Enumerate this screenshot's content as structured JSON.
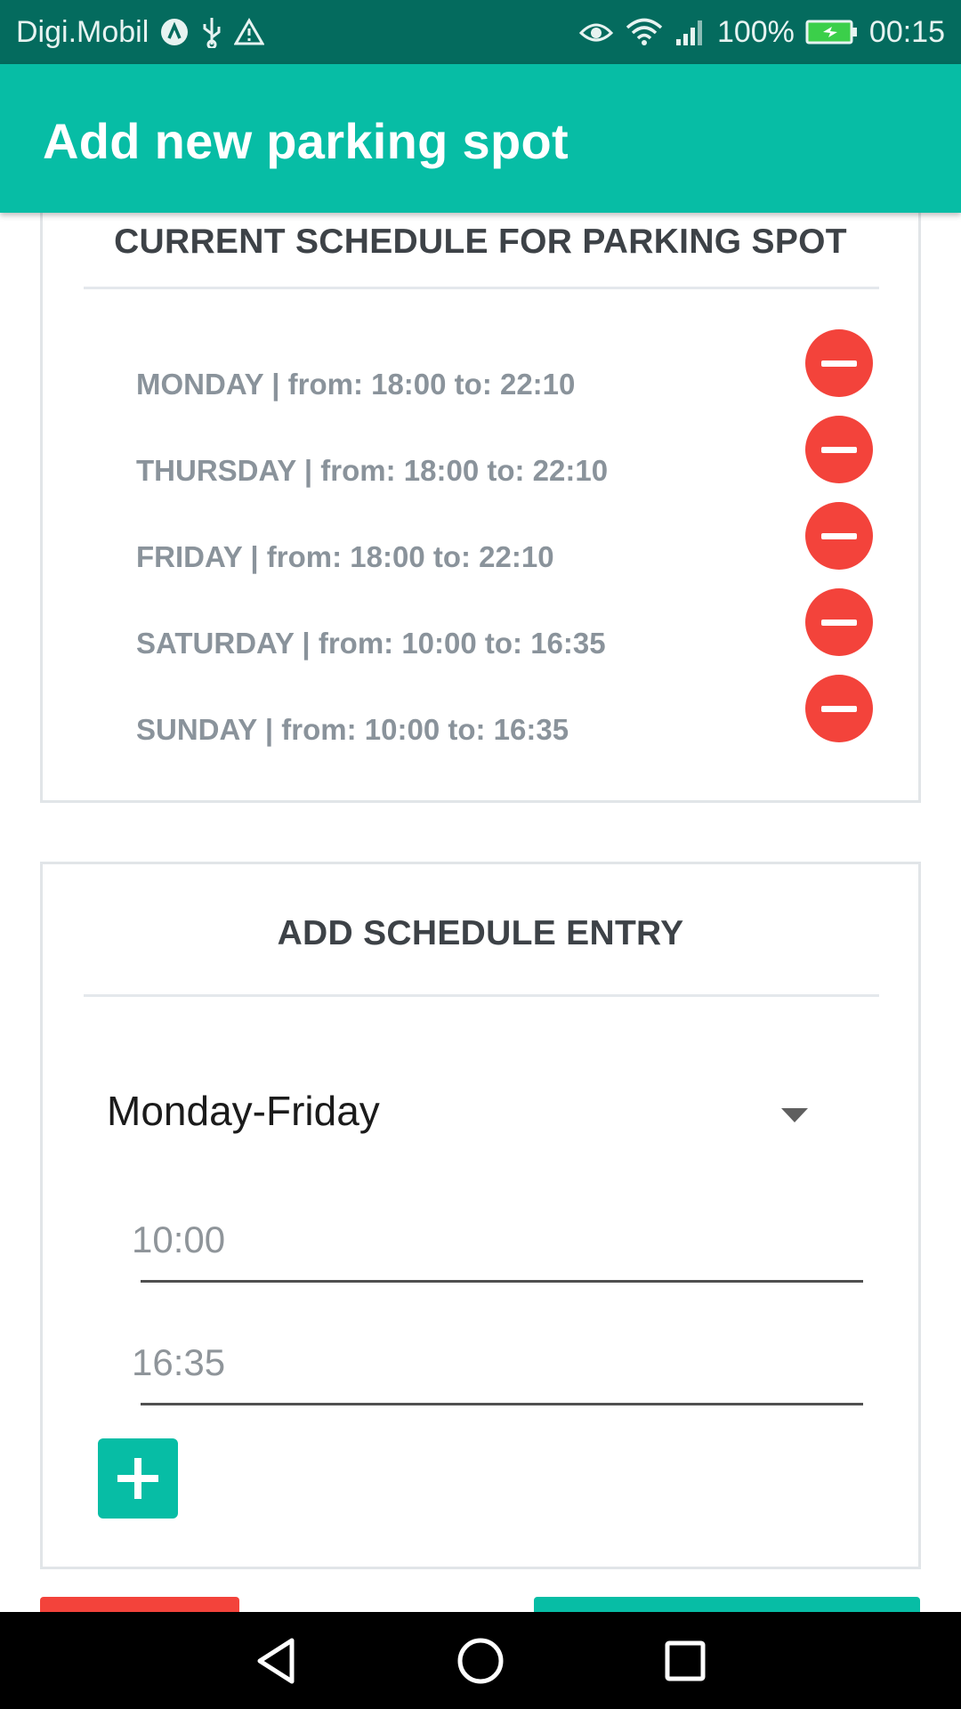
{
  "status_bar": {
    "carrier": "Digi.Mobil",
    "battery": "100%",
    "time": "00:15",
    "icons": [
      "carrier-logo-icon",
      "usb-icon",
      "warning-icon",
      "eye-icon",
      "wifi-icon",
      "signal-icon",
      "battery-charging-icon"
    ]
  },
  "app_bar": {
    "title": "Add new parking spot"
  },
  "schedule_card": {
    "title": "CURRENT SCHEDULE FOR PARKING SPOT",
    "entries": [
      {
        "text": "MONDAY | from: 18:00 to: 22:10"
      },
      {
        "text": "THURSDAY | from: 18:00 to: 22:10"
      },
      {
        "text": "FRIDAY | from: 18:00 to: 22:10"
      },
      {
        "text": "SATURDAY | from: 10:00 to: 16:35"
      },
      {
        "text": "SUNDAY | from: 10:00 to: 16:35"
      }
    ],
    "remove_icon": "minus-circle-icon"
  },
  "add_card": {
    "title": "ADD SCHEDULE ENTRY",
    "day_select": {
      "value": "Monday-Friday"
    },
    "from_time": "10:00",
    "to_time": "16:35",
    "add_icon": "plus-icon"
  },
  "colors": {
    "status_bar": "#046b5e",
    "app_bar": "#07bda5",
    "remove": "#f3433b",
    "accent": "#07bda5",
    "entry_text": "#8a939b"
  },
  "nav_bar": {
    "icons": [
      "back-icon",
      "home-icon",
      "recents-icon"
    ]
  }
}
